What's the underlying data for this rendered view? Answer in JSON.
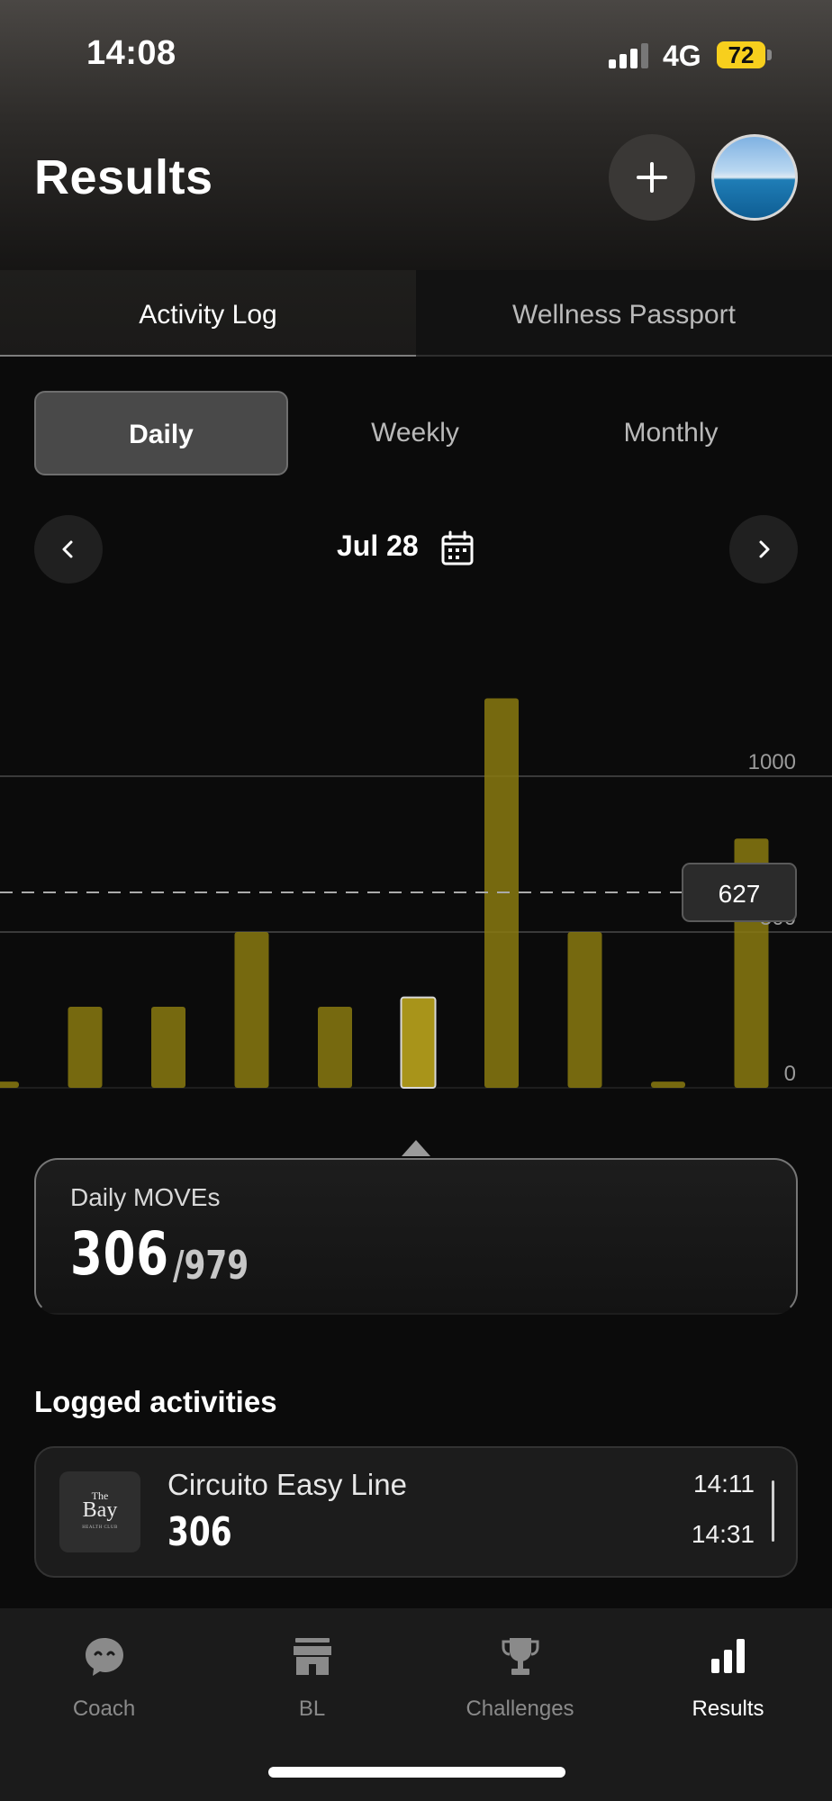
{
  "status_bar": {
    "time": "14:08",
    "network": "4G",
    "battery": "72"
  },
  "header": {
    "title": "Results",
    "add_icon": "plus-icon",
    "avatar_icon": "profile-avatar"
  },
  "tabs": [
    {
      "label": "Activity Log",
      "active": true
    },
    {
      "label": "Wellness Passport",
      "active": false
    }
  ],
  "periods": [
    {
      "label": "Daily",
      "active": true
    },
    {
      "label": "Weekly",
      "active": false
    },
    {
      "label": "Monthly",
      "active": false
    }
  ],
  "date_nav": {
    "label": "Jul 28",
    "prev_icon": "chevron-left-icon",
    "next_icon": "chevron-right-icon",
    "calendar_icon": "calendar-icon"
  },
  "colors": {
    "accent": "#f7cf1d",
    "bar": "#8a7a10",
    "selected_bar": "#a8941a"
  },
  "chart_data": {
    "type": "bar",
    "values": [
      20,
      260,
      260,
      500,
      260,
      290,
      1250,
      500,
      20,
      800
    ],
    "selected_index": 5,
    "average": 627,
    "average_label": "627",
    "ylim": [
      0,
      1000
    ],
    "y_ticks": [
      0,
      500,
      1000
    ],
    "y_tick_labels": [
      "0",
      "500",
      "1000"
    ]
  },
  "summary": {
    "label": "Daily MOVEs",
    "value": "306",
    "goal": "/979"
  },
  "logged": {
    "title": "Logged activities",
    "items": [
      {
        "name": "Circuito Easy Line",
        "value": "306",
        "start": "14:11",
        "end": "14:31",
        "logo_the": "The",
        "logo_bay": "Bay",
        "logo_sub": "HEALTH CLUB"
      }
    ]
  },
  "bottom_nav": [
    {
      "label": "Coach",
      "icon": "chat-face-icon",
      "active": false
    },
    {
      "label": "BL",
      "icon": "storefront-icon",
      "active": false
    },
    {
      "label": "Challenges",
      "icon": "trophy-icon",
      "active": false
    },
    {
      "label": "Results",
      "icon": "bar-chart-icon",
      "active": true
    }
  ]
}
